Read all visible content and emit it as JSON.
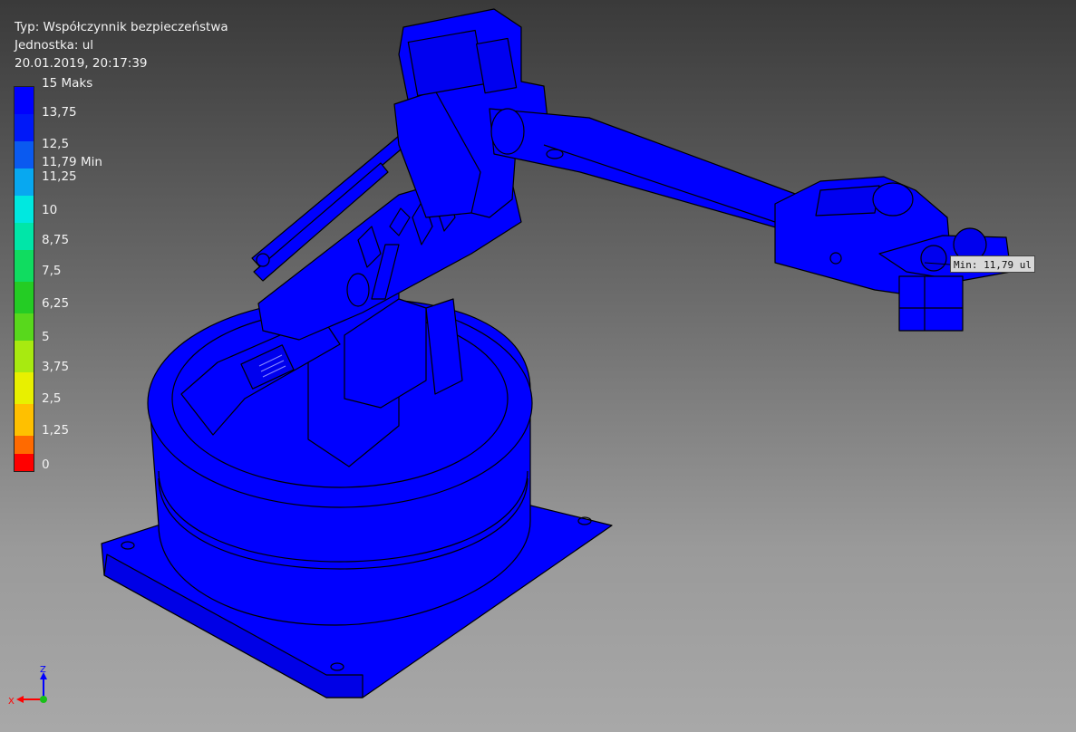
{
  "header": {
    "type_line": "Typ: Współczynnik bezpieczeństwa",
    "unit_line": "Jednostka: ul",
    "date_line": "20.01.2019, 20:17:39"
  },
  "legend": {
    "ticks": [
      "15 Maks",
      "13,75",
      "12,5",
      "11,79 Min",
      "11,25",
      "10",
      "8,75",
      "7,5",
      "6,25",
      "5",
      "3,75",
      "2,5",
      "1,25",
      "0"
    ],
    "colors": [
      "#0000ff",
      "#0a44f0",
      "#0a8cf0",
      "#08c0ee",
      "#00e8e0",
      "#00e6a8",
      "#10dc60",
      "#24cc24",
      "#58d81c",
      "#a8ea10",
      "#e8f000",
      "#ffc000",
      "#ff6a00",
      "#ff0000"
    ],
    "values": {
      "max": 15,
      "min": 11.79
    }
  },
  "probe": {
    "label": "Min: 11,79 ul"
  },
  "triad": {
    "z": "Z",
    "x": "X"
  },
  "colors": {
    "model": "#0000ff",
    "edge": "#000000"
  }
}
